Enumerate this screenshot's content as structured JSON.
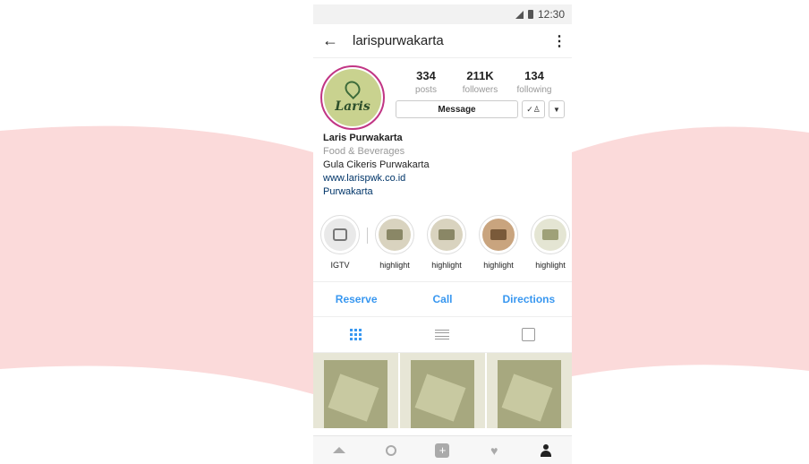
{
  "status_bar": {
    "time": "12:30"
  },
  "header": {
    "username": "larispurwakarta"
  },
  "avatar": {
    "brand_text": "Laris"
  },
  "stats": [
    {
      "value": "334",
      "label": "posts"
    },
    {
      "value": "211K",
      "label": "followers"
    },
    {
      "value": "134",
      "label": "following"
    }
  ],
  "actions": {
    "message_label": "Message"
  },
  "bio": {
    "name": "Laris Purwakarta",
    "category": "Food & Beverages",
    "description": "Gula Cikeris Purwakarta",
    "website": "www.larispwk.co.id",
    "location": "Purwakarta"
  },
  "highlights": [
    {
      "label": "IGTV"
    },
    {
      "label": "highlight"
    },
    {
      "label": "highlight"
    },
    {
      "label": "highlight"
    },
    {
      "label": "highlight"
    }
  ],
  "cta": {
    "reserve": "Reserve",
    "call": "Call",
    "directions": "Directions"
  },
  "colors": {
    "accent": "#3897f0",
    "ribbon": "#fbdada",
    "avatar_ring": "#c13584"
  },
  "icons": [
    "back-arrow-icon",
    "more-vert-icon",
    "grid-icon",
    "list-icon",
    "tagged-icon",
    "home-icon",
    "search-icon",
    "add-icon",
    "heart-icon",
    "profile-icon"
  ]
}
